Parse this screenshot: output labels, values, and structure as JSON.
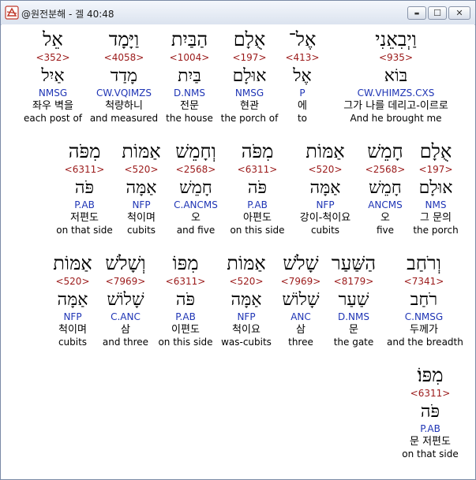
{
  "window": {
    "title": "@원전분해 - 겔 40:48",
    "minimize_glyph": "▬",
    "maximize_glyph": "☐",
    "close_glyph": "✕"
  },
  "rows": [
    [
      {
        "heb": "וַיְבִאֵנִי",
        "strong": "<935>",
        "lex": "בּוֹא",
        "parse": "CW.VHIMZS.CXS",
        "kor": "그가 나를 데리고-이르로",
        "eng": "And he brought me"
      },
      {
        "heb": "אֶל־",
        "strong": "<413>",
        "lex": "אֶל",
        "parse": "P",
        "kor": "에",
        "eng": "to"
      },
      {
        "heb": "אֻלָם",
        "strong": "<197>",
        "lex": "אוּלָם",
        "parse": "NMSG",
        "kor": "현관",
        "eng": "the porch of"
      },
      {
        "heb": "הַבַּיִת",
        "strong": "<1004>",
        "lex": "בַּיִת",
        "parse": "D.NMS",
        "kor": "전문",
        "eng": "the house"
      },
      {
        "heb": "וַיָּמָד",
        "strong": "<4058>",
        "lex": "מָדַד",
        "parse": "CW.VQIMZS",
        "kor": "척량하니",
        "eng": "and measured"
      },
      {
        "heb": "אֵל",
        "strong": "<352>",
        "lex": "אַיִל",
        "parse": "NMSG",
        "kor": "좌우 벽을",
        "eng": "each post of"
      }
    ],
    [
      {
        "heb": "אֻלָם",
        "strong": "<197>",
        "lex": "אוּלָם",
        "parse": "NMS",
        "kor": "그 문의",
        "eng": "the porch"
      },
      {
        "heb": "חָמֵשׁ",
        "strong": "<2568>",
        "lex": "חָמֵשׁ",
        "parse": "ANCMS",
        "kor": "오",
        "eng": "five"
      },
      {
        "heb": "אַמּוֹת",
        "strong": "<520>",
        "lex": "אַמָּה",
        "parse": "NFP",
        "kor": "강이-척이요",
        "eng": "cubits"
      },
      {
        "heb": "מִפֹּה",
        "strong": "<6311>",
        "lex": "פֹּה",
        "parse": "P.AB",
        "kor": "아편도",
        "eng": "on this side"
      },
      {
        "heb": "וְחָמֵשׁ",
        "strong": "<2568>",
        "lex": "חָמֵשׁ",
        "parse": "C.ANCMS",
        "kor": "오",
        "eng": "and five"
      },
      {
        "heb": "אַמּוֹת",
        "strong": "<520>",
        "lex": "אַמָּה",
        "parse": "NFP",
        "kor": "척이며",
        "eng": "cubits"
      },
      {
        "heb": "מִפֹּה",
        "strong": "<6311>",
        "lex": "פֹּה",
        "parse": "P.AB",
        "kor": "저편도",
        "eng": "on that side"
      }
    ],
    [
      {
        "heb": "וְרֹחַב",
        "strong": "<7341>",
        "lex": "רֹחַב",
        "parse": "C.NMSG",
        "kor": "두께가",
        "eng": "and the breadth"
      },
      {
        "heb": "הַשַּׁעַר",
        "strong": "<8179>",
        "lex": "שַׁעַר",
        "parse": "D.NMS",
        "kor": "문",
        "eng": "the gate"
      },
      {
        "heb": "שָׁלֹשׁ",
        "strong": "<7969>",
        "lex": "שָׁלוֹשׁ",
        "parse": "ANC",
        "kor": "삼",
        "eng": "three"
      },
      {
        "heb": "אַמּוֹת",
        "strong": "<520>",
        "lex": "אַמָּה",
        "parse": "NFP",
        "kor": "척이요",
        "eng": "was-cubits"
      },
      {
        "heb": "מִפּוֹ",
        "strong": "<6311>",
        "lex": "פֹּה",
        "parse": "P.AB",
        "kor": "이편도",
        "eng": "on this side"
      },
      {
        "heb": "וְשָׁלֹשׁ",
        "strong": "<7969>",
        "lex": "שָׁלוֹשׁ",
        "parse": "C.ANC",
        "kor": "삼",
        "eng": "and three"
      },
      {
        "heb": "אַמּוֹת",
        "strong": "<520>",
        "lex": "אַמָּה",
        "parse": "NFP",
        "kor": "척이며",
        "eng": "cubits"
      }
    ],
    [
      {
        "heb": "מִפּוֹ׃",
        "strong": "<6311>",
        "lex": "פֹּה",
        "parse": "P.AB",
        "kor": "문 저편도",
        "eng": "on that side"
      }
    ]
  ]
}
